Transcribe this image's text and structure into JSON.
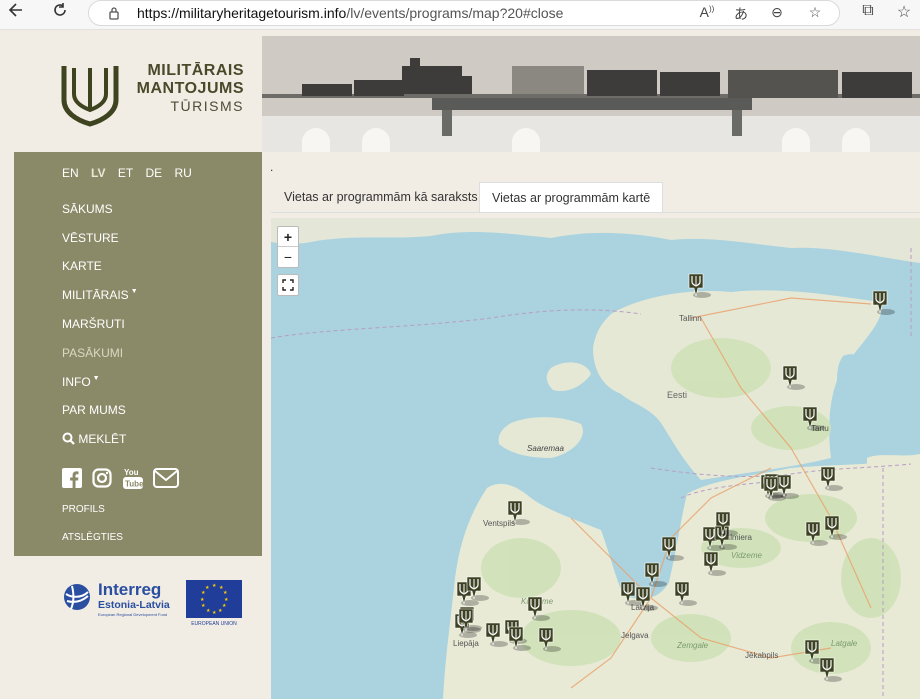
{
  "browser": {
    "url_host": "https://militaryheritagetourism.info",
    "url_path": "/lv/events/programs/map?20#close",
    "icons": [
      "back-arrow-icon",
      "refresh-icon",
      "lock-icon",
      "read-aloud-icon",
      "translate-icon",
      "zoom-out-icon",
      "add-favorite-icon",
      "extensions-icon",
      "favorites-icon"
    ]
  },
  "brand": {
    "line1": "MILITĀRAIS",
    "line2": "MANTOJUMS",
    "line3": "TŪRISMS"
  },
  "languages": [
    {
      "code": "EN",
      "active": false
    },
    {
      "code": "LV",
      "active": true
    },
    {
      "code": "ET",
      "active": false
    },
    {
      "code": "DE",
      "active": false
    },
    {
      "code": "RU",
      "active": false
    }
  ],
  "menu": [
    {
      "label": "SĀKUMS"
    },
    {
      "label": "VĒSTURE"
    },
    {
      "label": "KARTE"
    },
    {
      "label": "MILITĀRAIS",
      "dropdown": true
    },
    {
      "label": "MARŠRUTI"
    },
    {
      "label": "PASĀKUMI",
      "active": true
    },
    {
      "label": "INFO",
      "dropdown": true
    },
    {
      "label": "PAR MUMS"
    },
    {
      "label": "MEKLĒT",
      "icon": "search-icon"
    }
  ],
  "social": [
    "facebook-icon",
    "instagram-icon",
    "youtube-icon",
    "email-icon"
  ],
  "account": {
    "profile": "PROFILS",
    "logout": "ATSLĒGTIES"
  },
  "sponsors": {
    "interreg_title": "Interreg",
    "interreg_sub": "Estonia-Latvia",
    "interreg_fund": "European Regional Development Fund",
    "eu": "EUROPEAN UNION"
  },
  "tabs": [
    {
      "label": "Vietas ar programmām kā saraksts",
      "active": false
    },
    {
      "label": "Vietas ar programmām kartē",
      "active": true
    }
  ],
  "map": {
    "zoom_in": "+",
    "zoom_out": "−",
    "labels": {
      "tallinn": "Tallinn",
      "eesti": "Eesti",
      "saaremaa": "Saaremaa",
      "ventspils": "Ventspils",
      "riga": "Latvija",
      "jelgava": "Jelgava",
      "liepaja": "Liepāja",
      "jekabpils": "Jēkabpils",
      "zemgale": "Zemgale",
      "vidzeme": "Vidzeme",
      "kurzeme": "Kurzeme",
      "latgale": "Latgale",
      "tartu": "Tartu",
      "valmiera": "Valmiera"
    },
    "marker_icon": "heritage-pin-icon",
    "marker_count": 33
  }
}
